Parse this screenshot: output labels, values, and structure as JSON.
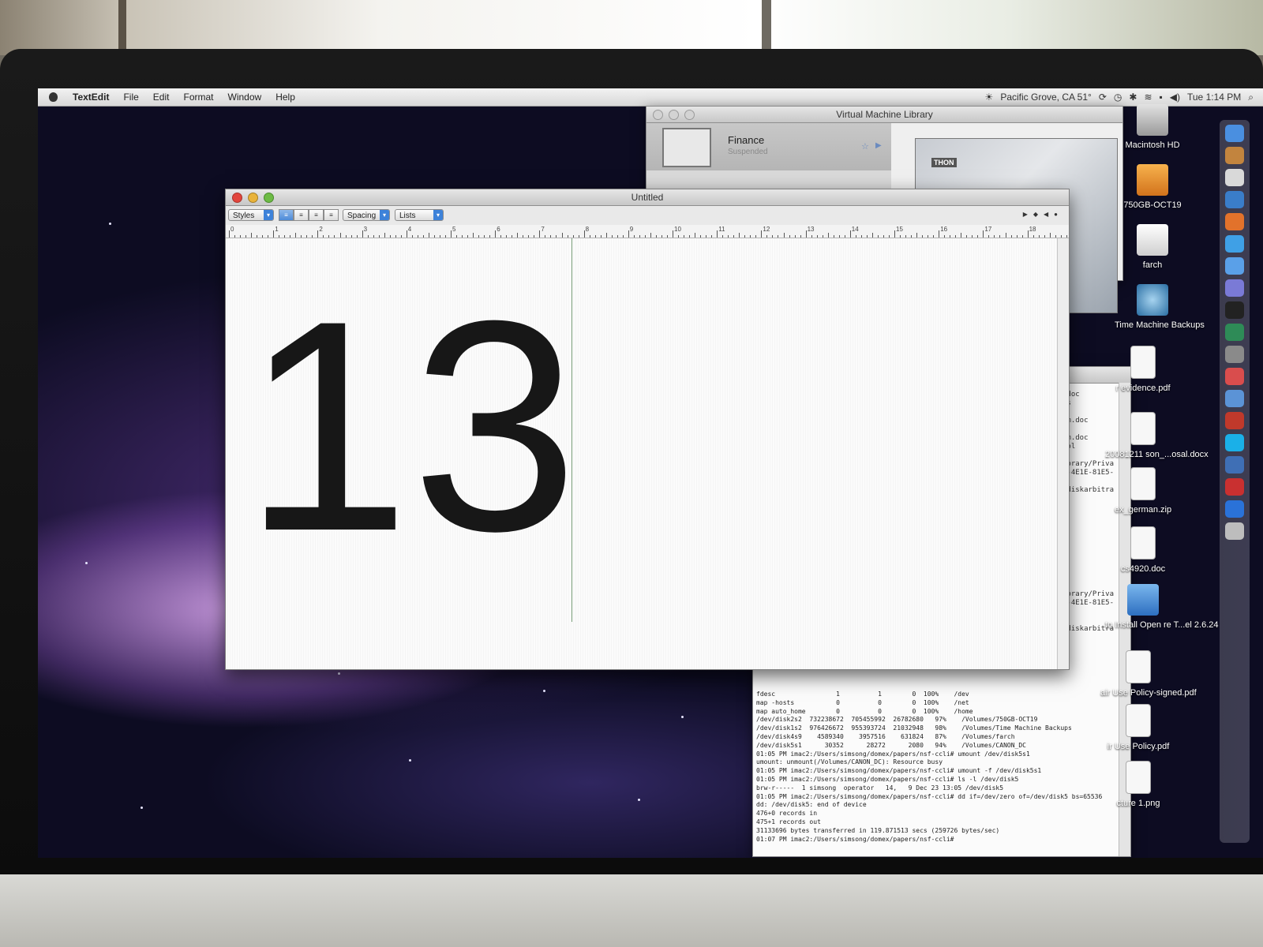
{
  "menubar": {
    "app_name": "TextEdit",
    "items": [
      "File",
      "Edit",
      "Format",
      "Window",
      "Help"
    ],
    "weather": "Pacific Grove, CA 51°",
    "clock": "Tue 1:14 PM"
  },
  "vm_library": {
    "title": "Virtual Machine Library",
    "vm_name": "Finance",
    "vm_status": "Suspended",
    "preview_badge": "THON"
  },
  "textedit": {
    "title": "Untitled",
    "styles_label": "Styles",
    "spacing_label": "Spacing",
    "lists_label": "Lists",
    "content": "13",
    "ruler_numbers": [
      "0",
      "1",
      "2",
      "3",
      "4",
      "5",
      "6",
      "7",
      "8",
      "9",
      "10",
      "11",
      "12",
      "13",
      "14",
      "15",
      "16",
      "17",
      "18"
    ]
  },
  "terminal": {
    "side_fragments": [
      ".doc",
      "ls",
      "",
      "rm.doc",
      "",
      "rm.doc",
      "rol",
      "",
      "ibrary/Priva",
      "8-4E1E-81E5-",
      "",
      "/diskarbitra",
      "",
      "",
      "",
      "",
      "",
      "",
      "",
      "",
      "",
      "",
      "",
      "ibrary/Priva",
      "8-4E1E-81E5-",
      "",
      "",
      "/diskarbitra"
    ],
    "lines": [
      "fdesc                1          1        0  100%    /dev",
      "map -hosts           0          0        0  100%    /net",
      "map auto_home        0          0        0  100%    /home",
      "/dev/disk2s2  732238672  705455992  26782680   97%    /Volumes/750GB-OCT19",
      "/dev/disk1s2  976426672  955393724  21032948   98%    /Volumes/Time Machine Backups",
      "/dev/disk4s9    4589340    3957516    631824   87%    /Volumes/farch",
      "/dev/disk5s1      30352      28272      2080   94%    /Volumes/CANON_DC",
      "01:05 PM imac2:/Users/simsong/domex/papers/nsf-ccli# umount /dev/disk5s1",
      "umount: unmount(/Volumes/CANON_DC): Resource busy",
      "01:05 PM imac2:/Users/simsong/domex/papers/nsf-ccli# umount -f /dev/disk5s1",
      "01:05 PM imac2:/Users/simsong/domex/papers/nsf-ccli# ls -l /dev/disk5",
      "brw-r-----  1 simsong  operator   14,   9 Dec 23 13:05 /dev/disk5",
      "01:05 PM imac2:/Users/simsong/domex/papers/nsf-ccli# dd if=/dev/zero of=/dev/disk5 bs=65536",
      "dd: /dev/disk5: end of device",
      "476+0 records in",
      "475+1 records out",
      "31133696 bytes transferred in 119.871513 secs (259726 bytes/sec)",
      "01:07 PM imac2:/Users/simsong/domex/papers/nsf-ccli# "
    ]
  },
  "desktop_icons": [
    {
      "label": "Macintosh HD",
      "icon": "hard-drive-icon"
    },
    {
      "label": "750GB-OCT19",
      "icon": "external-drive-icon"
    },
    {
      "label": "farch",
      "icon": "disk-image-icon"
    },
    {
      "label": "Time Machine Backups",
      "icon": "time-machine-icon"
    },
    {
      "label": "r evidence.pdf",
      "icon": "pdf-icon"
    },
    {
      "label": "20081211 son_...osal.docx",
      "icon": "docx-icon"
    },
    {
      "label": "ex_german.zip",
      "icon": "zip-icon"
    },
    {
      "label": "cs4920.doc",
      "icon": "doc-icon"
    },
    {
      "label": "to Install Open re T...el 2.6.24",
      "icon": "webloc-icon"
    },
    {
      "label": "air Use Policy-signed.pdf",
      "icon": "pdf-icon"
    },
    {
      "label": "ir Use Policy.pdf",
      "icon": "pdf-icon"
    },
    {
      "label": "cture 1.png",
      "icon": "png-icon"
    }
  ],
  "dock_icons": [
    "finder-icon",
    "preview-icon",
    "calendar-icon",
    "photo-icon",
    "firefox-icon",
    "safari-icon",
    "ichat-icon",
    "itunes-icon",
    "terminal-icon",
    "activity-monitor-icon",
    "system-prefs-icon",
    "font-icon",
    "mail-icon",
    "vm-icon",
    "skype-icon",
    "xcode-icon",
    "pdf-app-icon",
    "info-icon",
    "trash-icon"
  ]
}
